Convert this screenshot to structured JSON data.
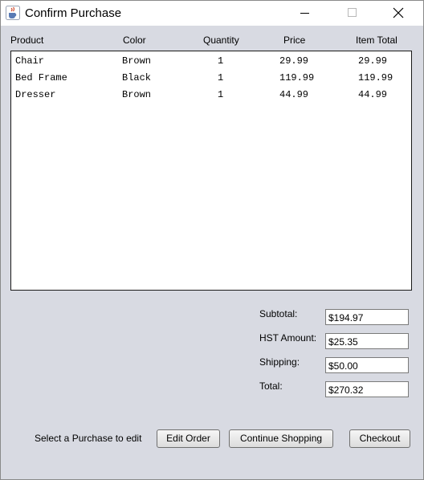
{
  "window": {
    "title": "Confirm Purchase",
    "icon": "java-coffee-cup-icon",
    "controls": [
      "minimize-icon",
      "maximize-icon",
      "close-icon"
    ]
  },
  "table": {
    "columns": [
      "Product",
      "Color",
      "Quantity",
      "Price",
      "Item Total"
    ],
    "rows": [
      [
        "Chair",
        "Brown",
        "1",
        "29.99",
        "29.99"
      ],
      [
        "Bed Frame",
        "Black",
        "1",
        "119.99",
        "119.99"
      ],
      [
        "Dresser",
        "Brown",
        "1",
        "44.99",
        "44.99"
      ]
    ]
  },
  "summary": {
    "subtotal_label": "Subtotal:",
    "subtotal_value": "$194.97",
    "hst_label": "HST Amount:",
    "hst_value": "$25.35",
    "shipping_label": "Shipping:",
    "shipping_value": "$50.00",
    "total_label": "Total:",
    "total_value": "$270.32"
  },
  "footer": {
    "hint": "Select a Purchase to edit",
    "edit_label": "Edit Order",
    "continue_label": "Continue Shopping",
    "checkout_label": "Checkout"
  }
}
